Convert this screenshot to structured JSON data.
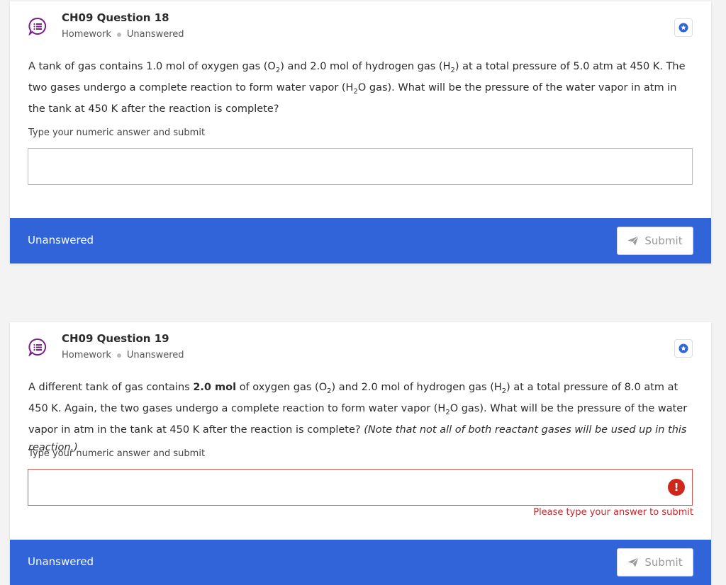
{
  "questions": [
    {
      "title": "CH09 Question 18",
      "category": "Homework",
      "state": "Unanswered",
      "text_parts": {
        "p1": "A tank of gas contains 1.0 mol of oxygen gas (O",
        "p2": ") and 2.0 mol of hydrogen gas (H",
        "p3": ") at a total pressure of 5.0 atm at 450 K. The two gases undergo a complete reaction to form water vapor (H",
        "p4": "O gas). What will be the pressure of the water vapor in atm in the tank at 450 K after the reaction is complete?",
        "sub2": "2"
      },
      "answer_prompt": "Type your numeric answer and submit",
      "answer_value": "",
      "footer_status": "Unanswered",
      "submit_label": "Submit"
    },
    {
      "title": "CH09 Question 19",
      "category": "Homework",
      "state": "Unanswered",
      "text_parts": {
        "p1": "A different tank of gas contains ",
        "bold": "2.0 mol",
        "p2": " of oxygen gas (O",
        "p3": ") and 2.0 mol of hydrogen gas (H",
        "p4": ") at a total pressure of 8.0 atm at 450 K. Again, the two gases undergo a complete reaction to form water vapor (H",
        "p5": "O gas). What will be the pressure of the water vapor in atm in the tank at 450 K after the reaction is complete? ",
        "italic": "(Note that not all of both reactant gases will be used up in this reaction.)",
        "sub2": "2"
      },
      "answer_prompt": "Type your numeric answer and submit",
      "answer_value": "",
      "error_message": "Please type your answer to submit",
      "footer_status": "Unanswered",
      "submit_label": "Submit"
    }
  ],
  "colors": {
    "footer_blue": "#3064d8",
    "error_red": "#d0271d",
    "icon_purple": "#7b1f8c",
    "star_blue": "#3064d8"
  },
  "icons": {
    "question_type": "chat-list-icon",
    "bookmark": "star-circle-icon",
    "error": "exclamation-icon",
    "submit": "paper-plane-icon"
  }
}
